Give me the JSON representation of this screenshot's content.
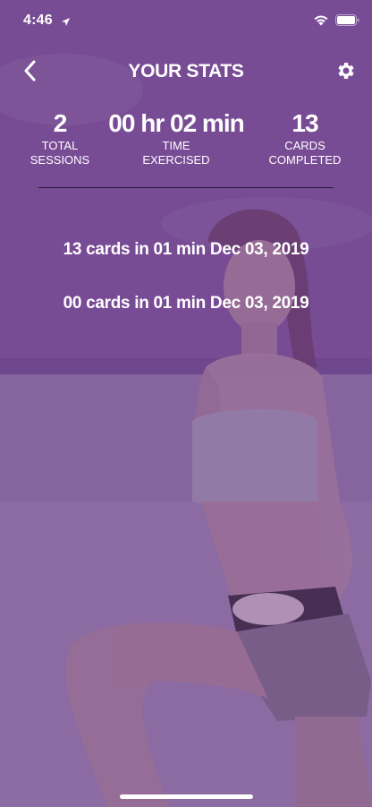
{
  "status_bar": {
    "time": "4:46"
  },
  "nav": {
    "title": "YOUR STATS"
  },
  "stats": [
    {
      "value": "2",
      "label_line1": "TOTAL",
      "label_line2": "SESSIONS"
    },
    {
      "value": "00 hr 02 min",
      "label_line1": "TIME",
      "label_line2": "EXERCISED"
    },
    {
      "value": "13",
      "label_line1": "CARDS",
      "label_line2": "COMPLETED"
    }
  ],
  "history": [
    {
      "text": "13 cards in 01 min Dec 03, 2019"
    },
    {
      "text": "00 cards in 01 min Dec 03, 2019"
    }
  ],
  "colors": {
    "overlay_purple": "#7a4e92",
    "text": "#ffffff",
    "divider": "#2a1a38"
  },
  "icons": {
    "back": "chevron-left-icon",
    "settings": "gear-icon",
    "location": "location-arrow-icon",
    "wifi": "wifi-icon",
    "battery": "battery-icon"
  }
}
